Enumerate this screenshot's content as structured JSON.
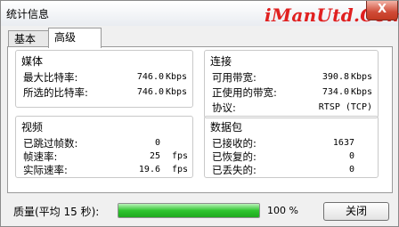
{
  "window": {
    "title": "统计信息",
    "close_glyph": "X",
    "watermark": "iManUtd.Com"
  },
  "tabs": [
    {
      "label": "基本",
      "active": false
    },
    {
      "label": "高级",
      "active": true
    }
  ],
  "media": {
    "title": "媒体",
    "rows": [
      {
        "label": "最大比特率:",
        "value": "746.0",
        "unit": "Kbps"
      },
      {
        "label": "所选的比特率:",
        "value": "746.0",
        "unit": "Kbps"
      }
    ]
  },
  "connection": {
    "title": "连接",
    "rows": [
      {
        "label": "可用带宽:",
        "value": "390.8",
        "unit": "Kbps"
      },
      {
        "label": "正使用的带宽:",
        "value": "734.0",
        "unit": "Kbps"
      },
      {
        "label": "协议:",
        "value": "RTSP (TCP)",
        "unit": ""
      }
    ]
  },
  "video": {
    "title": "视频",
    "rows": [
      {
        "label": "已跳过帧数:",
        "value": "0",
        "unit": ""
      },
      {
        "label": "帧速率:",
        "value": "25",
        "unit": "fps"
      },
      {
        "label": "实际速率:",
        "value": "19.6",
        "unit": "fps"
      }
    ]
  },
  "packets": {
    "title": "数据包",
    "rows": [
      {
        "label": "已接收的:",
        "value": "1637",
        "unit": ""
      },
      {
        "label": "已恢复的:",
        "value": "0",
        "unit": ""
      },
      {
        "label": "已丢失的:",
        "value": "0",
        "unit": ""
      }
    ]
  },
  "footer": {
    "quality_label": "质量(平均 15 秒):",
    "quality_value": "100 %",
    "quality_fraction": 1.0,
    "progress_color": "#2fc52f",
    "close_label": "关闭"
  }
}
